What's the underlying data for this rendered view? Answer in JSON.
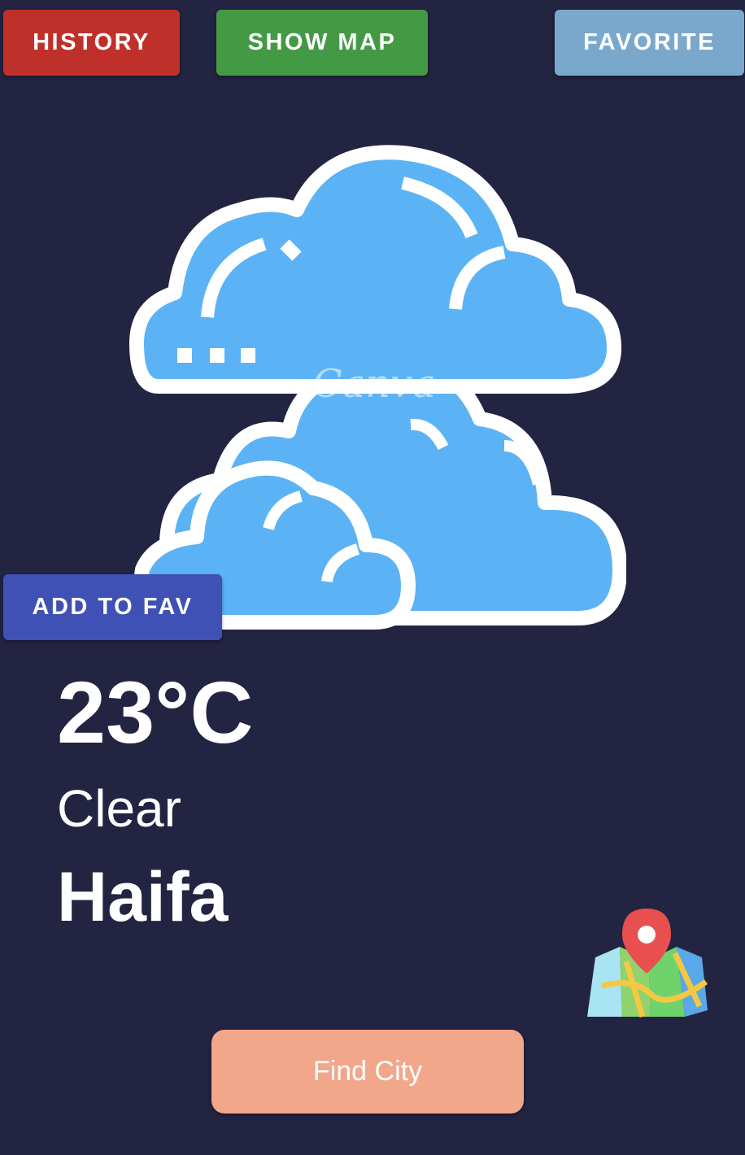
{
  "toolbar": {
    "history_label": "HISTORY",
    "show_map_label": "SHOW MAP",
    "favorite_label": "FAVORITE"
  },
  "actions": {
    "add_to_fav_label": "ADD TO FAV",
    "find_city_label": "Find City"
  },
  "weather": {
    "temperature": "23°C",
    "condition": "Clear",
    "city": "Haifa",
    "icon": "clouds-icon",
    "watermark": "Canva"
  },
  "map_icon": "map-pin-icon",
  "colors": {
    "background": "#232342",
    "history": "#c0302a",
    "show_map": "#449944",
    "favorite": "#7aa8cc",
    "add_to_fav": "#3f51b5",
    "find_city": "#f2a78a",
    "cloud_fill": "#5bb3f5",
    "cloud_outline": "#ffffff"
  }
}
